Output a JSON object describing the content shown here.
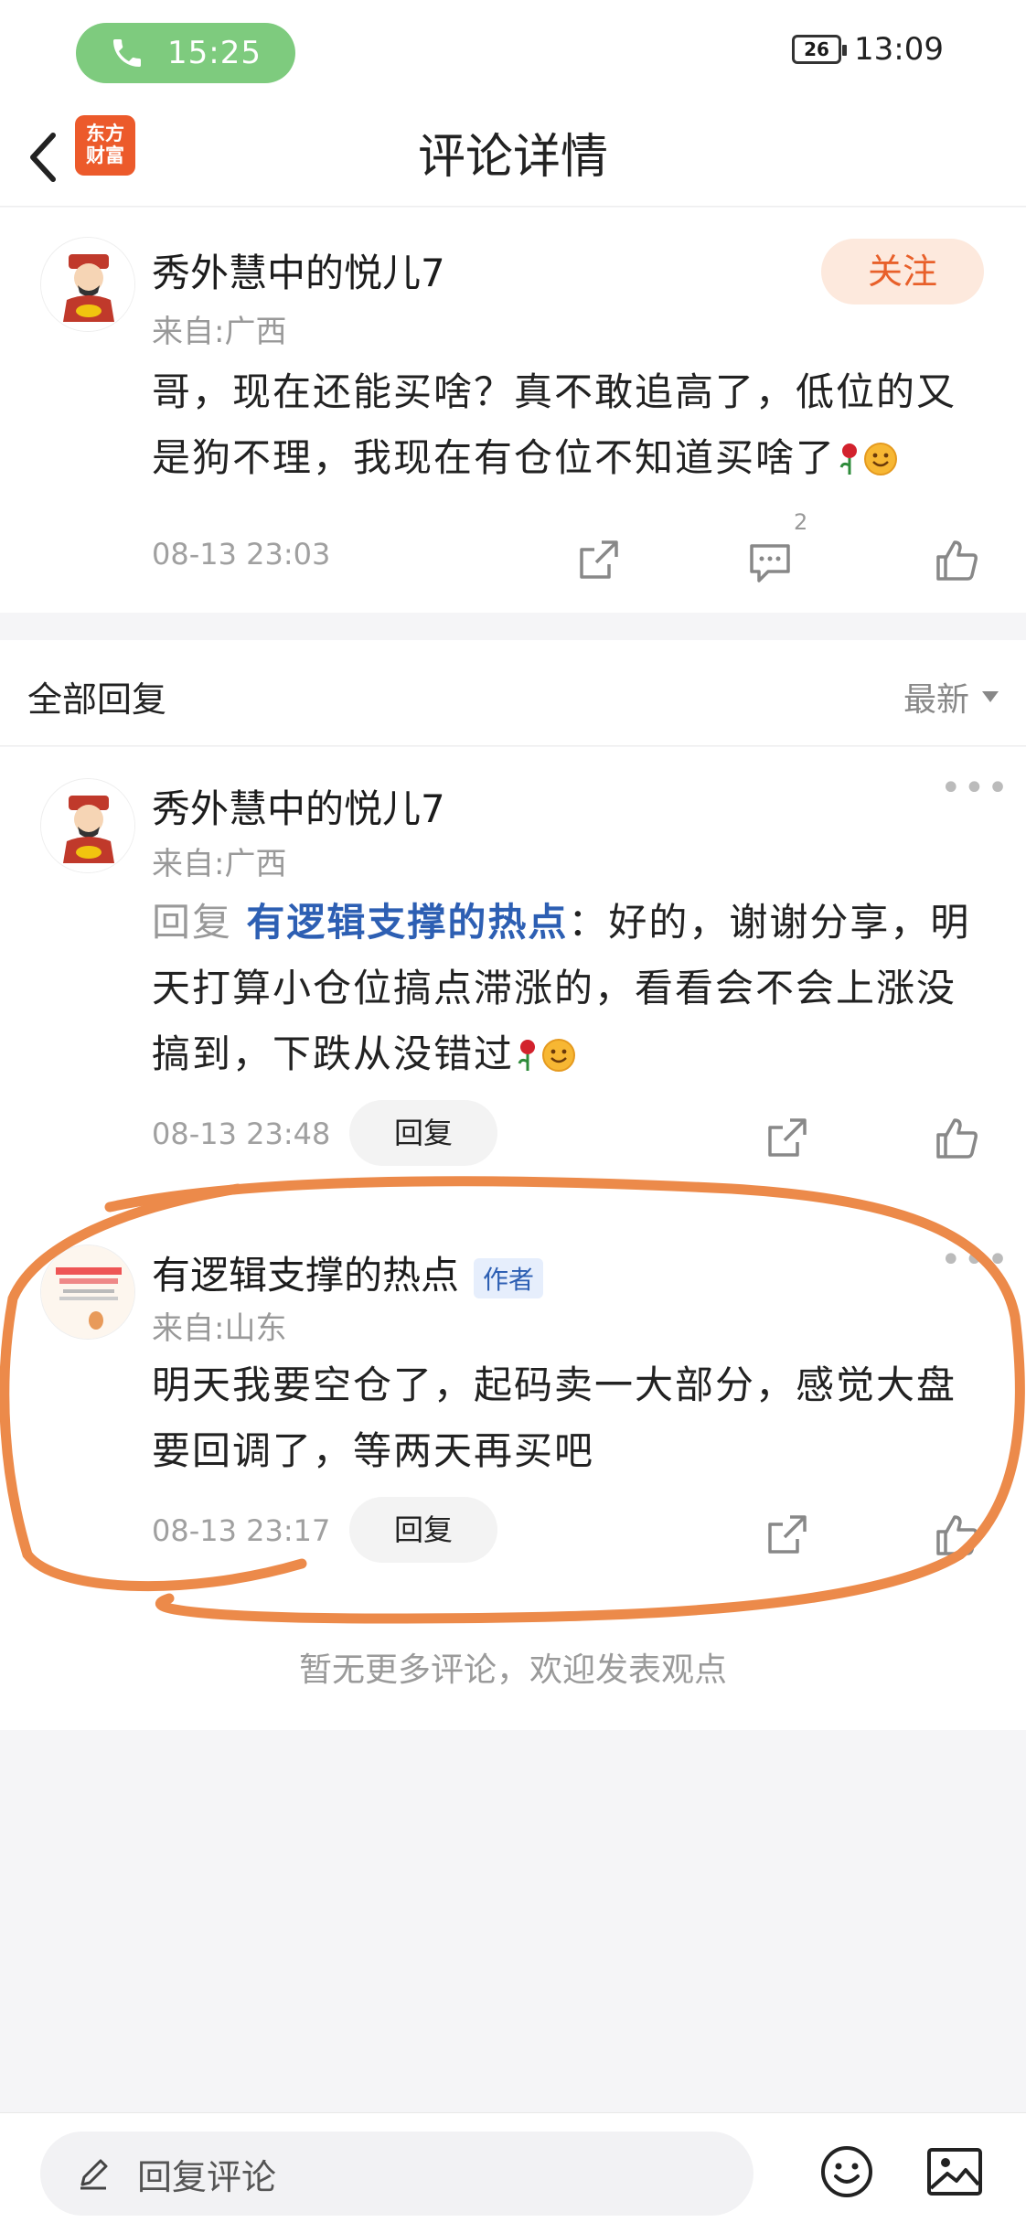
{
  "status_bar": {
    "call_time": "15:25",
    "battery": "26",
    "clock": "13:09"
  },
  "header": {
    "title": "评论详情",
    "logo_line1": "东方",
    "logo_line2": "财富"
  },
  "main_comment": {
    "username": "秀外慧中的悦儿7",
    "location": "来自:广西",
    "follow_label": "关注",
    "text": "哥，现在还能买啥？真不敢追高了，低位的又是狗不理，我现在有仓位不知道买啥了",
    "time": "08-13 23:03",
    "comment_count": "2"
  },
  "replies_section": {
    "title": "全部回复",
    "sort_label": "最新",
    "items": [
      {
        "username": "秀外慧中的悦儿7",
        "location": "来自:广西",
        "reply_prefix": "回复",
        "reply_to": "有逻辑支撑的热点",
        "text": "：好的，谢谢分享，明天打算小仓位搞点滞涨的，看看会不会上涨没搞到，下跌从没错过",
        "time": "08-13 23:48",
        "reply_label": "回复"
      },
      {
        "username": "有逻辑支撑的热点",
        "badge": "作者",
        "location": "来自:山东",
        "text": "明天我要空仓了，起码卖一大部分，感觉大盘要回调了，等两天再买吧",
        "time": "08-13 23:17",
        "reply_label": "回复"
      }
    ],
    "footer_note": "暂无更多评论，欢迎发表观点"
  },
  "bottom_bar": {
    "input_placeholder": "回复评论"
  },
  "colors": {
    "accent": "#e8602a",
    "link": "#2d5fb3",
    "annotation": "#ec8a4a",
    "call_green": "#7ecb7e"
  }
}
